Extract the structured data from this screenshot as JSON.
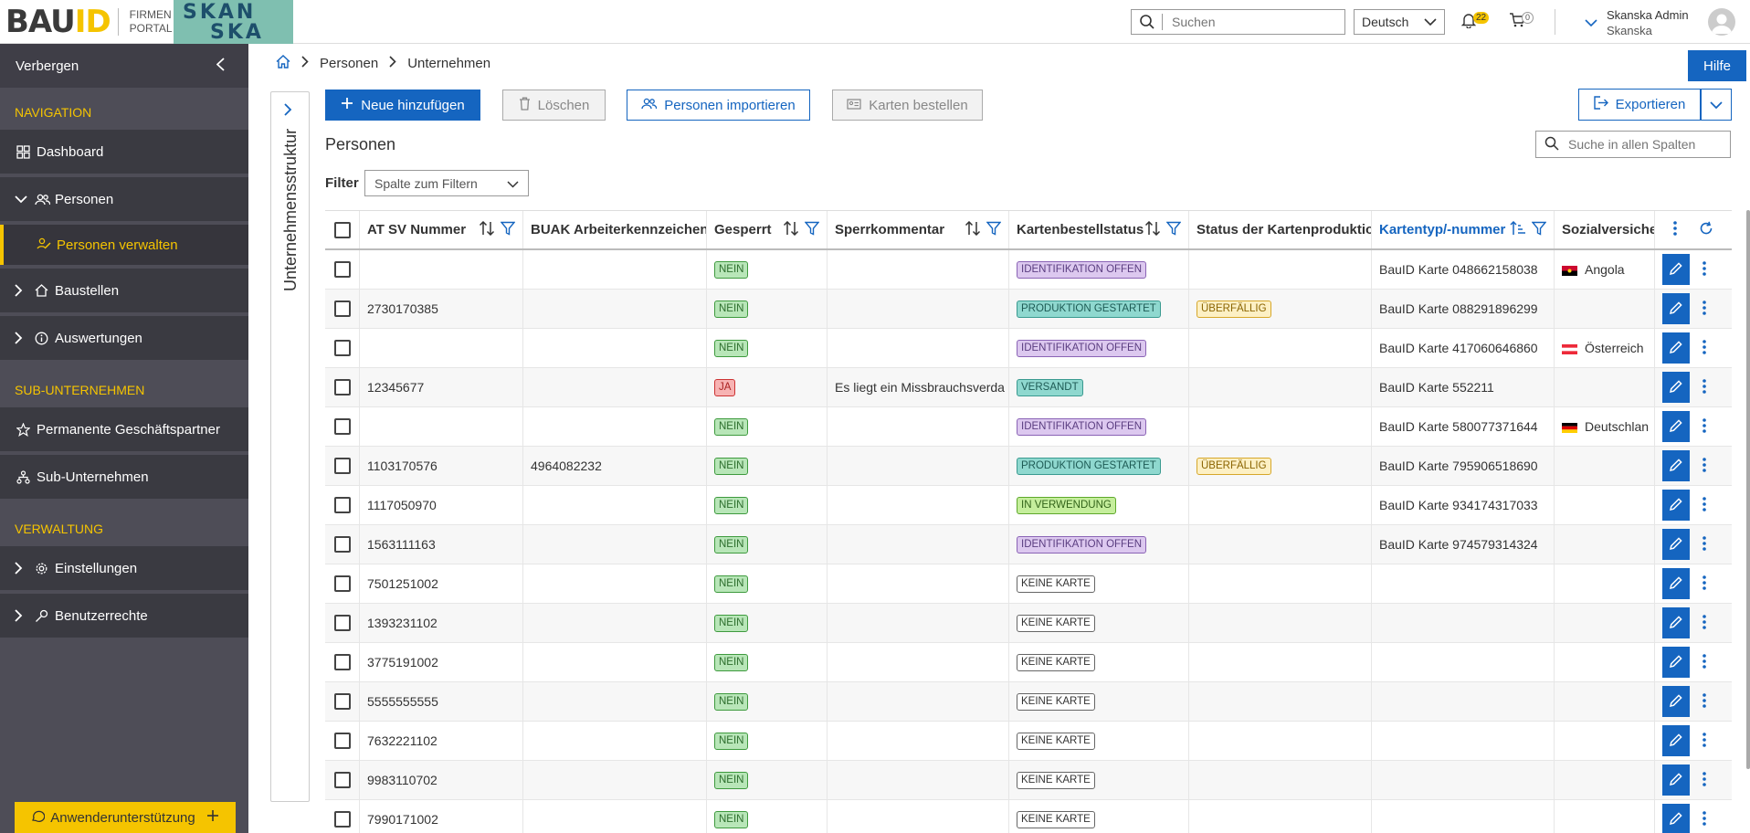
{
  "header": {
    "logo_bau": "BAU",
    "logo_id": "ID",
    "logo_sub1": "FIRMEN",
    "logo_sub2": "PORTAL",
    "partner_logo_l1": "SKAN",
    "partner_logo_l2": "SKA",
    "search_placeholder": "Suchen",
    "language": "Deutsch",
    "notification_count": "22",
    "cart_count": "0",
    "user_name": "Skanska Admin",
    "user_company": "Skanska"
  },
  "sidebar": {
    "hide_label": "Verbergen",
    "sections": {
      "navigation": "NAVIGATION",
      "sub": "SUB-UNTERNEHMEN",
      "admin": "VERWALTUNG"
    },
    "items": {
      "dashboard": "Dashboard",
      "personen": "Personen",
      "personen_verwalten": "Personen verwalten",
      "baustellen": "Baustellen",
      "auswertungen": "Auswertungen",
      "partner": "Permanente Geschäftspartner",
      "subunternehmen": "Sub-Unternehmen",
      "einstellungen": "Einstellungen",
      "benutzerrechte": "Benutzerrechte"
    },
    "support": "Anwenderunterstützung"
  },
  "side_tab": "Unternehmensstruktur",
  "breadcrumb": [
    "Personen",
    "Unternehmen"
  ],
  "help": "Hilfe",
  "toolbar": {
    "add": "Neue hinzufügen",
    "delete": "Löschen",
    "import": "Personen importieren",
    "order_cards": "Karten bestellen",
    "export": "Exportieren"
  },
  "page_title": "Personen",
  "column_search_placeholder": "Suche in allen Spalten",
  "filter": {
    "label": "Filter",
    "select": "Spalte zum Filtern"
  },
  "table": {
    "headers": {
      "sv": "AT SV Nummer",
      "buak": "BUAK Arbeiterkennzeichen (",
      "gesperrt": "Gesperrt",
      "kommentar": "Sperrkommentar",
      "bestell": "Kartenbestellstatus",
      "produktion": "Status der Kartenproduktion",
      "kartentyp": "Kartentyp/-nummer",
      "sozial": "Sozialversicher"
    },
    "rows": [
      {
        "sv": "",
        "buak": "",
        "gesperrt": "NEIN",
        "gtype": "nein",
        "kommentar": "",
        "bestell": "IDENTIFIKATION OFFEN",
        "btype": "ident",
        "prod": "",
        "karte": "BauID Karte 048662158038",
        "land": "Angola",
        "flag": "angola"
      },
      {
        "sv": "2730170385",
        "buak": "",
        "gesperrt": "NEIN",
        "gtype": "nein",
        "kommentar": "",
        "bestell": "PRODUKTION GESTARTET",
        "btype": "prod",
        "prod": "ÜBERFÄLLIG",
        "karte": "BauID Karte 088291896299",
        "land": "",
        "flag": ""
      },
      {
        "sv": "",
        "buak": "",
        "gesperrt": "NEIN",
        "gtype": "nein",
        "kommentar": "",
        "bestell": "IDENTIFIKATION OFFEN",
        "btype": "ident",
        "prod": "",
        "karte": "BauID Karte 417060646860",
        "land": "Österreich",
        "flag": "austria"
      },
      {
        "sv": "12345677",
        "buak": "",
        "gesperrt": "JA",
        "gtype": "ja",
        "kommentar": "Es liegt ein Missbrauchsverda",
        "bestell": "VERSANDT",
        "btype": "vers",
        "prod": "",
        "karte": "BauID Karte 552211",
        "land": "",
        "flag": ""
      },
      {
        "sv": "",
        "buak": "",
        "gesperrt": "NEIN",
        "gtype": "nein",
        "kommentar": "",
        "bestell": "IDENTIFIKATION OFFEN",
        "btype": "ident",
        "prod": "",
        "karte": "BauID Karte 580077371644",
        "land": "Deutschlan",
        "flag": "germany"
      },
      {
        "sv": "1103170576",
        "buak": "4964082232",
        "gesperrt": "NEIN",
        "gtype": "nein",
        "kommentar": "",
        "bestell": "PRODUKTION GESTARTET",
        "btype": "prod",
        "prod": "ÜBERFÄLLIG",
        "karte": "BauID Karte 795906518690",
        "land": "",
        "flag": ""
      },
      {
        "sv": "1117050970",
        "buak": "",
        "gesperrt": "NEIN",
        "gtype": "nein",
        "kommentar": "",
        "bestell": "IN VERWENDUNG",
        "btype": "inverw",
        "prod": "",
        "karte": "BauID Karte 934174317033",
        "land": "",
        "flag": ""
      },
      {
        "sv": "1563111163",
        "buak": "",
        "gesperrt": "NEIN",
        "gtype": "nein",
        "kommentar": "",
        "bestell": "IDENTIFIKATION OFFEN",
        "btype": "ident",
        "prod": "",
        "karte": "BauID Karte 974579314324",
        "land": "",
        "flag": ""
      },
      {
        "sv": "7501251002",
        "buak": "",
        "gesperrt": "NEIN",
        "gtype": "nein",
        "kommentar": "",
        "bestell": "KEINE KARTE",
        "btype": "keine",
        "prod": "",
        "karte": "",
        "land": "",
        "flag": ""
      },
      {
        "sv": "1393231102",
        "buak": "",
        "gesperrt": "NEIN",
        "gtype": "nein",
        "kommentar": "",
        "bestell": "KEINE KARTE",
        "btype": "keine",
        "prod": "",
        "karte": "",
        "land": "",
        "flag": ""
      },
      {
        "sv": "3775191002",
        "buak": "",
        "gesperrt": "NEIN",
        "gtype": "nein",
        "kommentar": "",
        "bestell": "KEINE KARTE",
        "btype": "keine",
        "prod": "",
        "karte": "",
        "land": "",
        "flag": ""
      },
      {
        "sv": "5555555555",
        "buak": "",
        "gesperrt": "NEIN",
        "gtype": "nein",
        "kommentar": "",
        "bestell": "KEINE KARTE",
        "btype": "keine",
        "prod": "",
        "karte": "",
        "land": "",
        "flag": ""
      },
      {
        "sv": "7632221102",
        "buak": "",
        "gesperrt": "NEIN",
        "gtype": "nein",
        "kommentar": "",
        "bestell": "KEINE KARTE",
        "btype": "keine",
        "prod": "",
        "karte": "",
        "land": "",
        "flag": ""
      },
      {
        "sv": "9983110702",
        "buak": "",
        "gesperrt": "NEIN",
        "gtype": "nein",
        "kommentar": "",
        "bestell": "KEINE KARTE",
        "btype": "keine",
        "prod": "",
        "karte": "",
        "land": "",
        "flag": ""
      },
      {
        "sv": "7990171002",
        "buak": "",
        "gesperrt": "NEIN",
        "gtype": "nein",
        "kommentar": "",
        "bestell": "KEINE KARTE",
        "btype": "keine",
        "prod": "",
        "karte": "",
        "land": "",
        "flag": ""
      }
    ]
  },
  "colors": {
    "primary": "#1565c0",
    "accent": "#f5c400",
    "sidebar": "#4e4d57"
  }
}
